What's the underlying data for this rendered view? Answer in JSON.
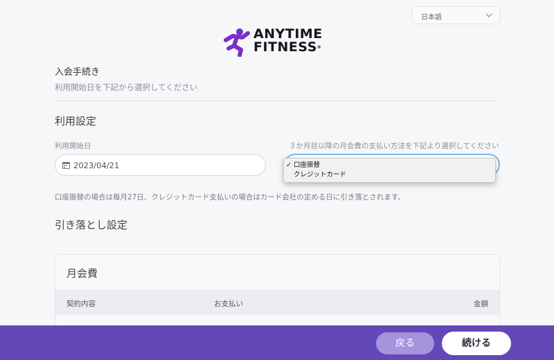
{
  "language": {
    "selected": "日本語"
  },
  "logo": {
    "line1": "ANYTIME",
    "line2": "FITNESS",
    "reg": "®",
    "brand_color": "#7b2fc9"
  },
  "intro": {
    "title": "入会手続き",
    "subtitle": "利用開始日を下記から選択してください"
  },
  "usage": {
    "heading": "利用設定",
    "start_label": "利用開始日",
    "start_value": "2023/04/21",
    "payment_label": "３か月目以降の月会費の支払い方法を下記より選択してください",
    "payment_options": [
      {
        "label": "口座振替",
        "selected": true
      },
      {
        "label": "クレジットカード",
        "selected": false
      }
    ],
    "note": "口座振替の場合は毎月27日、クレジットカード支払いの場合はカード会社の定める日に引き落とされます。"
  },
  "debit": {
    "heading": "引き落とし設定"
  },
  "fee_card": {
    "title": "月会費",
    "columns": [
      "契約内容",
      "お支払い",
      "金額"
    ]
  },
  "footer": {
    "back_label": "戻る",
    "next_label": "続ける",
    "bar_color": "#6348b8"
  }
}
